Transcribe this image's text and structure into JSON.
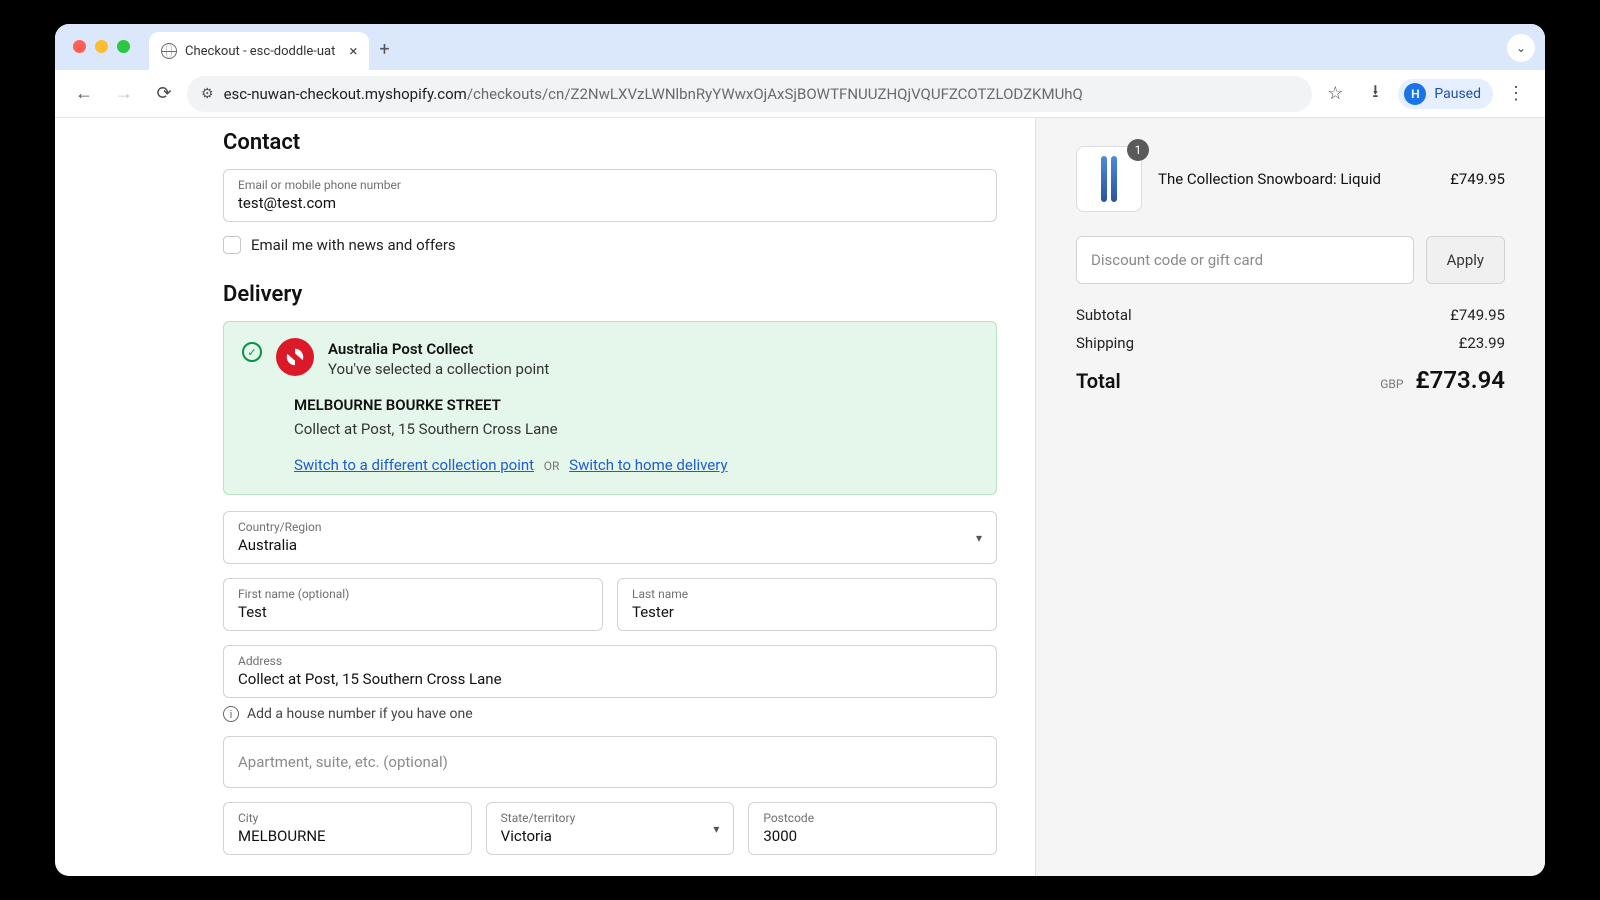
{
  "browser": {
    "tab_title": "Checkout - esc-doddle-uat",
    "url_host": "esc-nuwan-checkout.myshopify.com",
    "url_path": "/checkouts/cn/Z2NwLXVzLWNlbnRyYWwxOjAxSjBOWTFNUUZHQjVQUFZCOTZLODZKMUhQ",
    "profile_initial": "H",
    "profile_state": "Paused"
  },
  "contact": {
    "heading": "Contact",
    "email_label": "Email or mobile phone number",
    "email_value": "test@test.com",
    "news_checkbox": "Email me with news and offers"
  },
  "delivery": {
    "heading": "Delivery",
    "collect": {
      "title": "Australia Post Collect",
      "subtitle": "You've selected a collection point",
      "location_name": "MELBOURNE BOURKE STREET",
      "location_addr": "Collect at Post, 15 Southern Cross Lane",
      "switch_point": "Switch to a different collection point",
      "or": "OR",
      "switch_home": "Switch to home delivery"
    },
    "country_label": "Country/Region",
    "country_value": "Australia",
    "first_name_label": "First name (optional)",
    "first_name_value": "Test",
    "last_name_label": "Last name",
    "last_name_value": "Tester",
    "address_label": "Address",
    "address_value": "Collect at Post, 15 Southern Cross Lane",
    "address_hint": "Add a house number if you have one",
    "apt_placeholder": "Apartment, suite, etc. (optional)",
    "city_label": "City",
    "city_value": "MELBOURNE",
    "state_label": "State/territory",
    "state_value": "Victoria",
    "postcode_label": "Postcode",
    "postcode_value": "3000"
  },
  "summary": {
    "item_name": "The Collection Snowboard: Liquid",
    "item_qty": "1",
    "item_price": "£749.95",
    "discount_placeholder": "Discount code or gift card",
    "apply": "Apply",
    "subtotal_label": "Subtotal",
    "subtotal_value": "£749.95",
    "shipping_label": "Shipping",
    "shipping_value": "£23.99",
    "total_label": "Total",
    "total_currency": "GBP",
    "total_value": "£773.94"
  }
}
